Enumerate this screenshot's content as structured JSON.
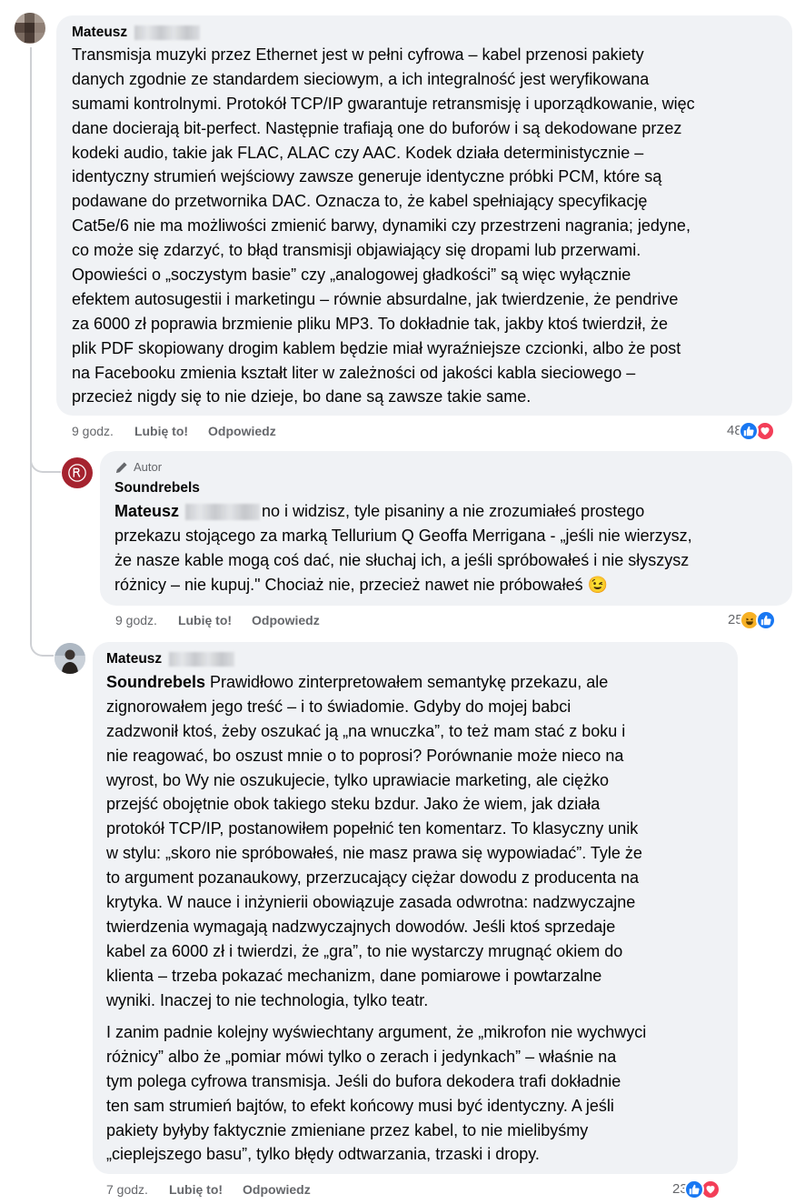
{
  "comments": [
    {
      "author": "Mateusz",
      "lines": [
        "Transmisja muzyki przez Ethernet jest w pełni cyfrowa – kabel przenosi pakiety",
        "danych zgodnie ze standardem sieciowym, a ich integralność jest weryfikowana",
        "sumami kontrolnymi. Protokół TCP/IP gwarantuje retransmisję i uporządkowanie, więc",
        "dane docierają bit-perfect. Następnie trafiają one do buforów i są dekodowane przez",
        "kodeki audio, takie jak FLAC, ALAC czy AAC. Kodek działa deterministycznie –",
        "identyczny strumień wejściowy zawsze generuje identyczne próbki PCM, które są",
        "podawane do przetwornika DAC. Oznacza to, że kabel spełniający specyfikację",
        "Cat5e/6 nie ma możliwości zmienić barwy, dynamiki czy przestrzeni nagrania; jedyne,",
        "co może się zdarzyć, to błąd transmisji objawiający się dropami lub przerwami.",
        "Opowieści o „soczystym basie” czy „analogowej gładkości” są więc wyłącznie",
        "efektem autosugestii i marketingu – równie absurdalne, jak twierdzenie, że pendrive",
        "za 6000 zł poprawia brzmienie pliku MP3. To dokładnie tak, jakby ktoś twierdził, że",
        "plik PDF skopiowany drogim kablem będzie miał wyraźniejsze czcionki, albo że post",
        "na Facebooku zmienia kształt liter w zależności od jakości kabla sieciowego –",
        "przecież nigdy się to nie dzieje, bo dane są zawsze takie same."
      ],
      "time": "9 godz.",
      "like_label": "Lubię to!",
      "reply_label": "Odpowiedz",
      "reaction_count": "48"
    },
    {
      "badge": "Autor",
      "author": "Soundrebels",
      "mention": "Mateusz",
      "lines": [
        "no i widzisz, tyle pisaniny a nie zrozumiałeś prostego",
        "przekazu stojącego za marką Tellurium Q Geoffa Merrigana - „jeśli nie wierzysz,",
        "że nasze kable mogą coś dać, nie słuchaj ich, a jeśli spróbowałeś i nie słyszysz",
        "różnicy – nie kupuj.\" Chociaż nie, przecież nawet nie próbowałeś 😉"
      ],
      "time": "9 godz.",
      "like_label": "Lubię to!",
      "reply_label": "Odpowiedz",
      "reaction_count": "25"
    },
    {
      "author": "Mateusz",
      "mention": "Soundrebels",
      "lines": [
        " Prawidłowo zinterpretowałem semantykę przekazu, ale",
        "zignorowałem jego treść – i to świadomie. Gdyby do mojej babci",
        "zadzwonił ktoś, żeby oszukać ją „na wnuczka”, to też mam stać z boku i",
        "nie reagować, bo oszust mnie o to poprosi? Porównanie może nieco na",
        "wyrost, bo Wy nie oszukujecie, tylko uprawiacie marketing, ale ciężko",
        "przejść obojętnie obok takiego steku bzdur. Jako że wiem, jak działa",
        "protokół TCP/IP, postanowiłem popełnić ten komentarz. To klasyczny unik",
        "w stylu: „skoro nie spróbowałeś, nie masz prawa się wypowiadać”. Tyle że",
        "to argument pozanaukowy, przerzucający ciężar dowodu z producenta na",
        "krytyka. W nauce i inżynierii obowiązuje zasada odwrotna: nadzwyczajne",
        "twierdzenia wymagają nadzwyczajnych dowodów. Jeśli ktoś sprzedaje",
        "kabel za 6000 zł i twierdzi, że „gra”, to nie wystarczy mrugnąć okiem do",
        "klienta – trzeba pokazać mechanizm, dane pomiarowe i powtarzalne",
        "wyniki. Inaczej to nie technologia, tylko teatr."
      ],
      "lines2": [
        "I zanim padnie kolejny wyświechtany argument, że „mikrofon nie wychwyci",
        "różnicy” albo że „pomiar mówi tylko o zerach i jedynkach” – właśnie na",
        "tym polega cyfrowa transmisja. Jeśli do bufora dekodera trafi dokładnie",
        "ten sam strumień bajtów, to efekt końcowy musi być identyczny. A jeśli",
        "pakiety byłyby faktycznie zmieniane przez kabel, to nie mielibyśmy",
        "„cieplejszego basu”, tylko błędy odtwarzania, trzaski i dropy."
      ],
      "time": "7 godz.",
      "like_label": "Lubię to!",
      "reply_label": "Odpowiedz",
      "reaction_count": "23"
    }
  ],
  "colors": {
    "bubble": "#f0f2f5",
    "meta_text": "#65676b",
    "like_blue": "#1877f2",
    "love_red": "#f33e58",
    "brand_red": "#a5232f"
  },
  "icons": [
    "pencil-icon",
    "like-reaction-icon",
    "love-reaction-icon",
    "haha-reaction-icon"
  ]
}
